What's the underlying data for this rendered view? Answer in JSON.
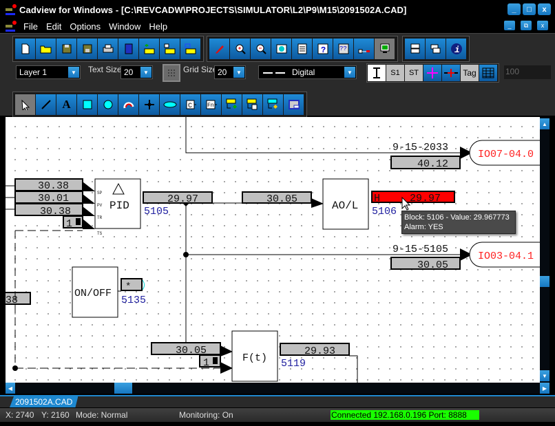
{
  "window": {
    "title": "Cadview for Windows - [C:\\REVCADW\\PROJECTS\\SIMULATOR\\L2\\P9\\M15\\2091502A.CAD]",
    "controls": {
      "minimize": "_",
      "maximize": "□",
      "close": "x"
    },
    "mdi_controls": {
      "minimize": "_",
      "restore": "⧉",
      "close": "x"
    }
  },
  "menu": [
    "File",
    "Edit",
    "Options",
    "Window",
    "Help"
  ],
  "toolbar1": {
    "file_group": [
      "new-file",
      "open-folder",
      "save",
      "save-as",
      "print",
      "library",
      "import-folder-green",
      "import-folder-h",
      "import-folder-blue"
    ],
    "view_group": [
      "pen",
      "zoom-in",
      "zoom-out",
      "zoom-1",
      "list",
      "help",
      "context-help",
      "connection",
      "monitor"
    ],
    "window_group": [
      "tile-horizontal",
      "cascade",
      "info"
    ]
  },
  "toolbar2": {
    "layer": "Layer 1",
    "text_size_label": "Text Size",
    "text_size": "20",
    "grid_size_label": "Grid Size",
    "grid_size": "20",
    "line_style": "Digital",
    "buttons": [
      "I-beam",
      "S1",
      "ST",
      "magenta-cross",
      "red-cross"
    ],
    "tag_label": "Tag",
    "value_field": "100"
  },
  "toolbar3": [
    "select",
    "line",
    "text",
    "rectangle",
    "circle",
    "arc",
    "junction",
    "ellipse",
    "constant",
    "function",
    "place-folder-green",
    "place-folder-n",
    "place-folder-yellow",
    "window-block"
  ],
  "diagram": {
    "pid": {
      "label": "PID",
      "tag": "5105",
      "inputs": [
        "SP",
        "PV",
        "TR",
        "TS"
      ],
      "sp": "30.38",
      "pv": "30.01",
      "tr": "30.38",
      "ts": "1",
      "output": "29.97"
    },
    "aol": {
      "label": "AO/L",
      "tag": "5106",
      "input": "30.05",
      "output_flag": "H",
      "output": "29.97"
    },
    "io1": {
      "date": "9-15-2033",
      "value": "40.12",
      "label": "IO07-04.0"
    },
    "io2": {
      "date": "9-15-5105",
      "value": "30.05",
      "label": "IO03-04.1"
    },
    "onoff": {
      "label": "ON/OFF",
      "tag": "5135",
      "value": "*"
    },
    "left_value": "38",
    "ft": {
      "label": "F(t)",
      "tag": "5119",
      "input": "30.05",
      "input2": "1",
      "output": "29.93"
    }
  },
  "tooltip": {
    "line1": "Block: 5106 - Value: 29.967773",
    "line2": "Alarm: YES"
  },
  "tabs": [
    "2091502A.CAD"
  ],
  "status": {
    "x": "X: 2740",
    "y": "Y: 2160",
    "mode": "Mode: Normal",
    "monitoring": "Monitoring: On",
    "connection": "Connected 192.168.0.196   Port: 8888"
  },
  "colors": {
    "accent": "#1e88d0",
    "alarm": "#ff0000",
    "connected": "#19ff00",
    "io_label": "#ff2020",
    "tag": "#2020a0"
  }
}
